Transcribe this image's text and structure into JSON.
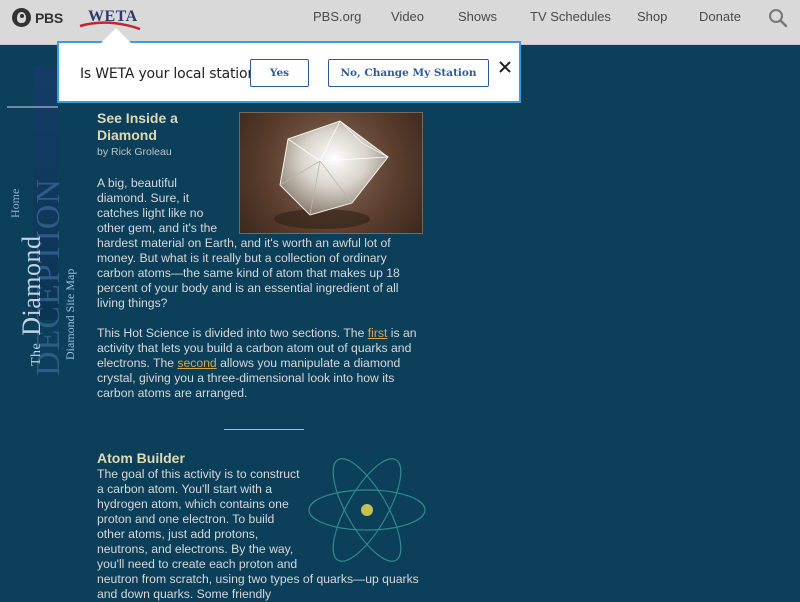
{
  "header": {
    "pbs_label": "PBS",
    "station_label": "WETA",
    "nav": [
      "PBS.org",
      "Video",
      "Shows",
      "TV Schedules",
      "Shop",
      "Donate"
    ]
  },
  "popup": {
    "question": "Is WETA your local station?",
    "yes_label": "Yes",
    "no_label": "No, Change My Station"
  },
  "sidebar": {
    "home_label": "Home",
    "title_the": "The",
    "title_diamond": "Diamond",
    "title_deception": "DECEPTION",
    "sitemap_label": "Diamond Site Map"
  },
  "article": {
    "title": "See Inside a Diamond",
    "byline": "by Rick Groleau",
    "intro": "A big, beautiful diamond. Sure, it catches light like no other gem, and it's the hardest material on Earth, and it's worth an awful lot of money. But what is it really but a collection of ordinary carbon atoms—the same kind of atom that makes up 18 percent of your body and is an essential ingredient of all living things?",
    "hot_pre": "This Hot Science is divided into two sections. The ",
    "first_link": "first",
    "hot_mid": " is an activity that lets you build a carbon atom out of quarks and electrons. The ",
    "second_link": "second",
    "hot_post": " allows you manipulate a diamond crystal, giving you a three-dimensional look into how its carbon atoms are arranged.",
    "atom_title": "Atom Builder",
    "atom_text": "The goal of this activity is to construct a carbon atom. You'll start with a hydrogen atom, which contains one proton and one electron. To build other atoms, just add protons, neutrons, and electrons. By the way, you'll need to create each proton and neutron from scratch, using two types of quarks—up quarks and down quarks. Some friendly"
  },
  "colors": {
    "page_bg": "#0b3f5a",
    "heading": "#dfd9b4",
    "link": "#d8a650",
    "popup_border": "#3b9ddd",
    "button_text": "#2e5a9c"
  }
}
